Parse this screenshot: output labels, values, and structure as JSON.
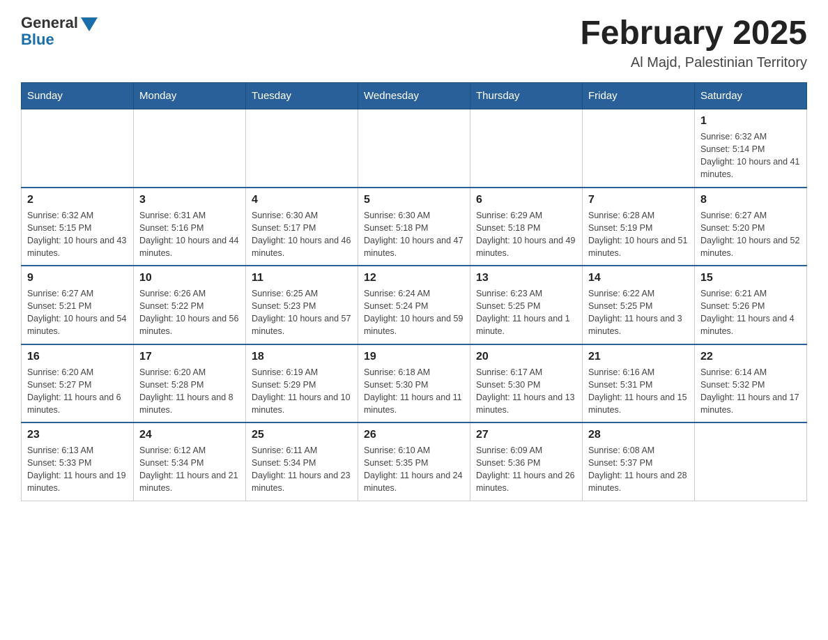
{
  "header": {
    "logo_general": "General",
    "logo_blue": "Blue",
    "month_title": "February 2025",
    "location": "Al Majd, Palestinian Territory"
  },
  "days_of_week": [
    "Sunday",
    "Monday",
    "Tuesday",
    "Wednesday",
    "Thursday",
    "Friday",
    "Saturday"
  ],
  "weeks": [
    [
      {
        "day": "",
        "info": ""
      },
      {
        "day": "",
        "info": ""
      },
      {
        "day": "",
        "info": ""
      },
      {
        "day": "",
        "info": ""
      },
      {
        "day": "",
        "info": ""
      },
      {
        "day": "",
        "info": ""
      },
      {
        "day": "1",
        "info": "Sunrise: 6:32 AM\nSunset: 5:14 PM\nDaylight: 10 hours and 41 minutes."
      }
    ],
    [
      {
        "day": "2",
        "info": "Sunrise: 6:32 AM\nSunset: 5:15 PM\nDaylight: 10 hours and 43 minutes."
      },
      {
        "day": "3",
        "info": "Sunrise: 6:31 AM\nSunset: 5:16 PM\nDaylight: 10 hours and 44 minutes."
      },
      {
        "day": "4",
        "info": "Sunrise: 6:30 AM\nSunset: 5:17 PM\nDaylight: 10 hours and 46 minutes."
      },
      {
        "day": "5",
        "info": "Sunrise: 6:30 AM\nSunset: 5:18 PM\nDaylight: 10 hours and 47 minutes."
      },
      {
        "day": "6",
        "info": "Sunrise: 6:29 AM\nSunset: 5:18 PM\nDaylight: 10 hours and 49 minutes."
      },
      {
        "day": "7",
        "info": "Sunrise: 6:28 AM\nSunset: 5:19 PM\nDaylight: 10 hours and 51 minutes."
      },
      {
        "day": "8",
        "info": "Sunrise: 6:27 AM\nSunset: 5:20 PM\nDaylight: 10 hours and 52 minutes."
      }
    ],
    [
      {
        "day": "9",
        "info": "Sunrise: 6:27 AM\nSunset: 5:21 PM\nDaylight: 10 hours and 54 minutes."
      },
      {
        "day": "10",
        "info": "Sunrise: 6:26 AM\nSunset: 5:22 PM\nDaylight: 10 hours and 56 minutes."
      },
      {
        "day": "11",
        "info": "Sunrise: 6:25 AM\nSunset: 5:23 PM\nDaylight: 10 hours and 57 minutes."
      },
      {
        "day": "12",
        "info": "Sunrise: 6:24 AM\nSunset: 5:24 PM\nDaylight: 10 hours and 59 minutes."
      },
      {
        "day": "13",
        "info": "Sunrise: 6:23 AM\nSunset: 5:25 PM\nDaylight: 11 hours and 1 minute."
      },
      {
        "day": "14",
        "info": "Sunrise: 6:22 AM\nSunset: 5:25 PM\nDaylight: 11 hours and 3 minutes."
      },
      {
        "day": "15",
        "info": "Sunrise: 6:21 AM\nSunset: 5:26 PM\nDaylight: 11 hours and 4 minutes."
      }
    ],
    [
      {
        "day": "16",
        "info": "Sunrise: 6:20 AM\nSunset: 5:27 PM\nDaylight: 11 hours and 6 minutes."
      },
      {
        "day": "17",
        "info": "Sunrise: 6:20 AM\nSunset: 5:28 PM\nDaylight: 11 hours and 8 minutes."
      },
      {
        "day": "18",
        "info": "Sunrise: 6:19 AM\nSunset: 5:29 PM\nDaylight: 11 hours and 10 minutes."
      },
      {
        "day": "19",
        "info": "Sunrise: 6:18 AM\nSunset: 5:30 PM\nDaylight: 11 hours and 11 minutes."
      },
      {
        "day": "20",
        "info": "Sunrise: 6:17 AM\nSunset: 5:30 PM\nDaylight: 11 hours and 13 minutes."
      },
      {
        "day": "21",
        "info": "Sunrise: 6:16 AM\nSunset: 5:31 PM\nDaylight: 11 hours and 15 minutes."
      },
      {
        "day": "22",
        "info": "Sunrise: 6:14 AM\nSunset: 5:32 PM\nDaylight: 11 hours and 17 minutes."
      }
    ],
    [
      {
        "day": "23",
        "info": "Sunrise: 6:13 AM\nSunset: 5:33 PM\nDaylight: 11 hours and 19 minutes."
      },
      {
        "day": "24",
        "info": "Sunrise: 6:12 AM\nSunset: 5:34 PM\nDaylight: 11 hours and 21 minutes."
      },
      {
        "day": "25",
        "info": "Sunrise: 6:11 AM\nSunset: 5:34 PM\nDaylight: 11 hours and 23 minutes."
      },
      {
        "day": "26",
        "info": "Sunrise: 6:10 AM\nSunset: 5:35 PM\nDaylight: 11 hours and 24 minutes."
      },
      {
        "day": "27",
        "info": "Sunrise: 6:09 AM\nSunset: 5:36 PM\nDaylight: 11 hours and 26 minutes."
      },
      {
        "day": "28",
        "info": "Sunrise: 6:08 AM\nSunset: 5:37 PM\nDaylight: 11 hours and 28 minutes."
      },
      {
        "day": "",
        "info": ""
      }
    ]
  ]
}
